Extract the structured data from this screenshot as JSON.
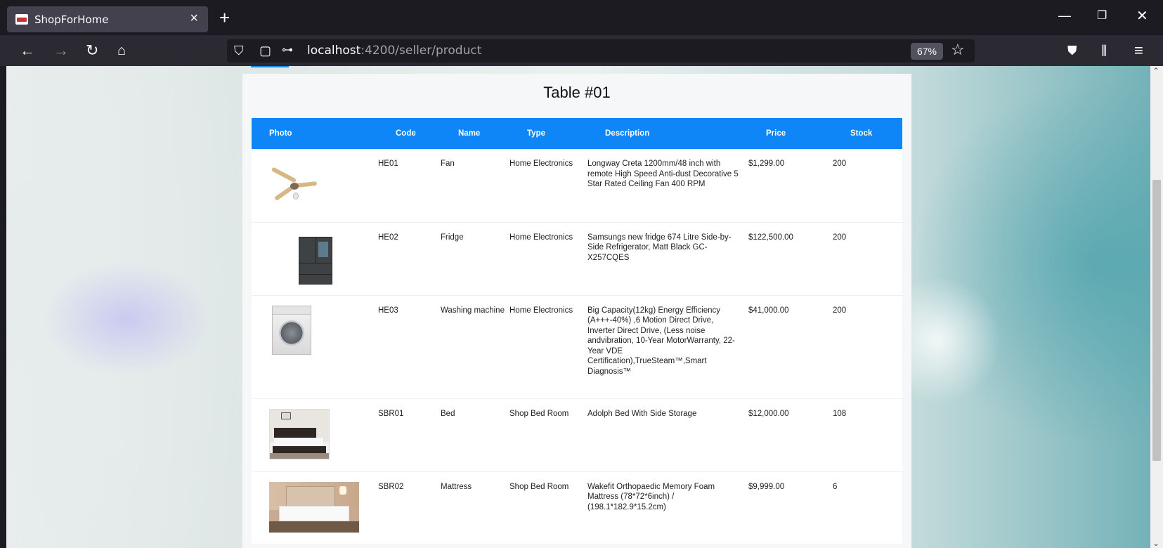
{
  "browser": {
    "tab_title": "ShopForHome",
    "url_host": "localhost",
    "url_rest": ":4200/seller/product",
    "zoom": "67%"
  },
  "page": {
    "table_title": "Table #01",
    "columns": [
      "Photo",
      "Code",
      "Name",
      "Type",
      "Description",
      "Price",
      "Stock"
    ],
    "rows": [
      {
        "photo": "ceiling-fan-photo",
        "code": "HE01",
        "name": "Fan",
        "type": "Home Electronics",
        "description": "Longway Creta 1200mm/48 inch with remote High Speed Anti-dust Decorative 5 Star Rated Ceiling Fan 400 RPM",
        "price": "$1,299.00",
        "stock": "200"
      },
      {
        "photo": "fridge-photo",
        "code": "HE02",
        "name": "Fridge",
        "type": "Home Electronics",
        "description": "Samsungs new fridge 674 Litre Side-by-Side Refrigerator, Matt Black GC-X257CQES",
        "price": "$122,500.00",
        "stock": "200"
      },
      {
        "photo": "washing-machine-photo",
        "code": "HE03",
        "name": "Washing machine",
        "type": "Home Electronics",
        "description": "Big Capacity(12kg) Energy Efficiency (A+++-40%) ,6 Motion Direct Drive, Inverter Direct Drive, (Less noise andvibration, 10-Year MotorWarranty, 22-Year VDE Certification),TrueSteam™,Smart Diagnosis™",
        "price": "$41,000.00",
        "stock": "200"
      },
      {
        "photo": "bed-photo",
        "code": "SBR01",
        "name": "Bed",
        "type": "Shop Bed Room",
        "description": "Adolph Bed With Side Storage",
        "price": "$12,000.00",
        "stock": "108"
      },
      {
        "photo": "mattress-photo",
        "code": "SBR02",
        "name": "Mattress",
        "type": "Shop Bed Room",
        "description": "Wakefit Orthopaedic Memory Foam Mattress (78*72*6inch) / (198.1*182.9*15.2cm)",
        "price": "$9,999.00",
        "stock": "6"
      }
    ]
  },
  "colors": {
    "header_blue": "#0e86f7",
    "chrome_dark": "#1c1b22",
    "chrome_toolbar": "#2b2a33"
  }
}
